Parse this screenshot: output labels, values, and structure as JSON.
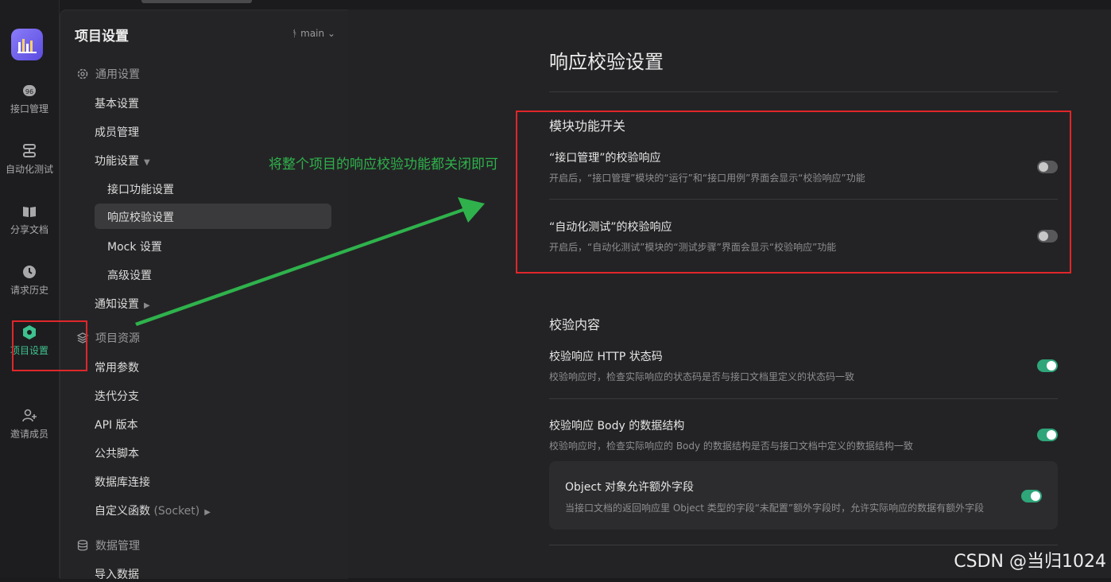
{
  "sidebar": {
    "items": [
      {
        "label": "接口管理",
        "icon": "api-icon"
      },
      {
        "label": "自动化测试",
        "icon": "automation-icon"
      },
      {
        "label": "分享文档",
        "icon": "book-icon"
      },
      {
        "label": "请求历史",
        "icon": "clock-icon"
      },
      {
        "label": "项目设置",
        "icon": "hexagon-icon"
      },
      {
        "label": "邀请成员",
        "icon": "add-user-icon"
      }
    ],
    "active_index": 4
  },
  "panel": {
    "title": "项目设置",
    "branch": "main",
    "general_section": "通用设置",
    "basic": "基本设置",
    "members": "成员管理",
    "features": "功能设置",
    "api_features": "接口功能设置",
    "response_validation": "响应校验设置",
    "mock": "Mock 设置",
    "advanced": "高级设置",
    "notifications": "通知设置",
    "resources_section": "项目资源",
    "common_params": "常用参数",
    "iteration_branch": "迭代分支",
    "api_version": "API 版本",
    "public_scripts": "公共脚本",
    "db_connection": "数据库连接",
    "custom_functions": "自定义函数",
    "custom_functions_suffix": "(Socket)",
    "data_section": "数据管理",
    "import_data": "导入数据"
  },
  "main": {
    "title": "响应校验设置",
    "module_switch": {
      "heading": "模块功能开关",
      "options": [
        {
          "title": "“接口管理”的校验响应",
          "desc": "开启后，“接口管理”模块的“运行”和“接口用例”界面会显示“校验响应”功能",
          "enabled": false
        },
        {
          "title": "“自动化测试”的校验响应",
          "desc": "开启后，“自动化测试”模块的“测试步骤”界面会显示“校验响应”功能",
          "enabled": false
        }
      ]
    },
    "content": {
      "heading": "校验内容",
      "options": [
        {
          "title": "校验响应 HTTP 状态码",
          "desc": "校验响应时，检查实际响应的状态码是否与接口文档里定义的状态码一致",
          "enabled": true
        },
        {
          "title": "校验响应 Body 的数据结构",
          "desc": "校验响应时，检查实际响应的 Body 的数据结构是否与接口文档中定义的数据结构一致",
          "enabled": true
        },
        {
          "title": "Object 对象允许额外字段",
          "desc": "当接口文档的返回响应里 Object 类型的字段“未配置”额外字段时，允许实际响应的数据有额外字段",
          "enabled": true
        }
      ]
    }
  },
  "annotation": {
    "text": "将整个项目的响应校验功能都关闭即可",
    "color": "#2fb24c",
    "highlight_color": "#e0262a"
  },
  "watermark": "CSDN @当归1024"
}
